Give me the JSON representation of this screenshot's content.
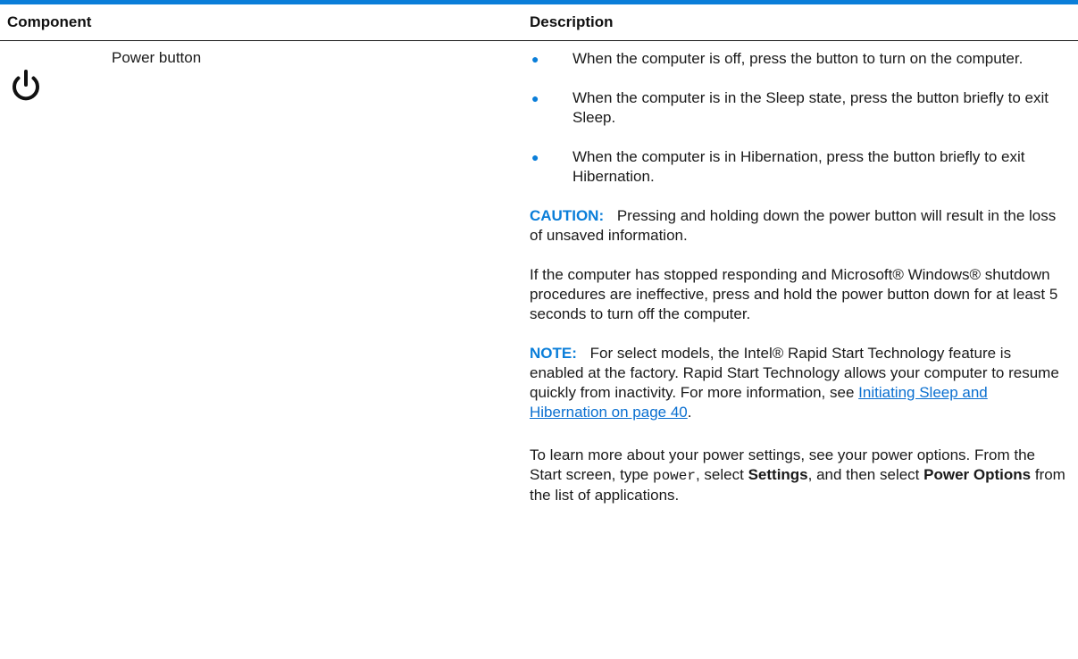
{
  "table": {
    "headers": {
      "component": "Component",
      "description": "Description"
    },
    "row": {
      "icon": "power-icon",
      "component_name": "Power button",
      "bullets": [
        "When the computer is off, press the button to turn on the computer.",
        "When the computer is in the Sleep state, press the button briefly to exit Sleep.",
        "When the computer is in Hibernation, press the button briefly to exit Hibernation."
      ],
      "caution": {
        "label": "CAUTION:",
        "text": "Pressing and holding down the power button will result in the loss of unsaved information."
      },
      "unresponsive_text": "If the computer has stopped responding and Microsoft® Windows® shutdown procedures are ineffective, press and hold the power button down for at least 5 seconds to turn off the computer.",
      "note": {
        "label": "NOTE:",
        "text": "For select models, the Intel® Rapid Start Technology feature is enabled at the factory. Rapid Start Technology allows your computer to resume quickly from inactivity. For more information, see",
        "link_text": "Initiating Sleep and Hibernation on page 40",
        "after_link": "."
      },
      "learn_more": {
        "part1": "To learn more about your power settings, see your power options. From the Start screen, type",
        "code": "power",
        "part2": ", select",
        "settings": "Settings",
        "part3": ", and then select",
        "power_options": "Power Options",
        "part4": "from the list of applications."
      }
    }
  },
  "colors": {
    "accent": "#0a7ed9",
    "link": "#0a6fd0",
    "text": "#1a1a1a"
  }
}
